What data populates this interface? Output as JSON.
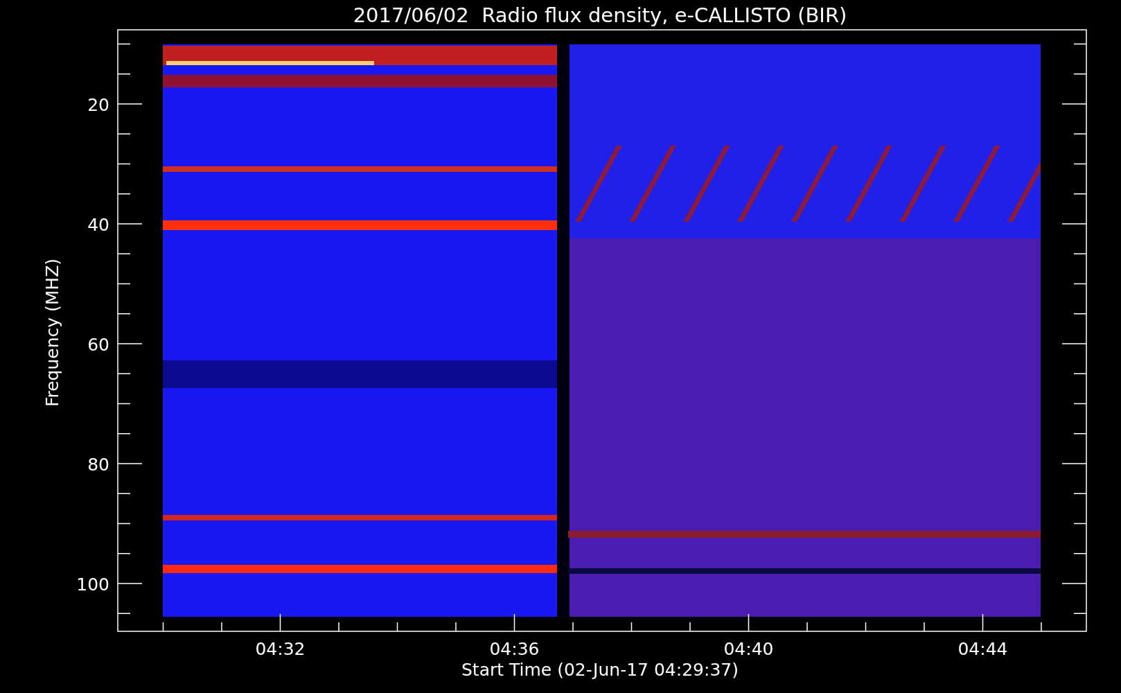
{
  "title": "2017/06/02  Radio flux density, e-CALLISTO (BIR)",
  "y_axis": {
    "label": "Frequency (MHZ)",
    "ticks": [
      "20",
      "40",
      "60",
      "80",
      "100"
    ]
  },
  "x_axis": {
    "label": "Start Time (02-Jun-17 04:29:37)",
    "ticks": [
      "04:32",
      "04:36",
      "04:40",
      "04:44"
    ]
  }
}
